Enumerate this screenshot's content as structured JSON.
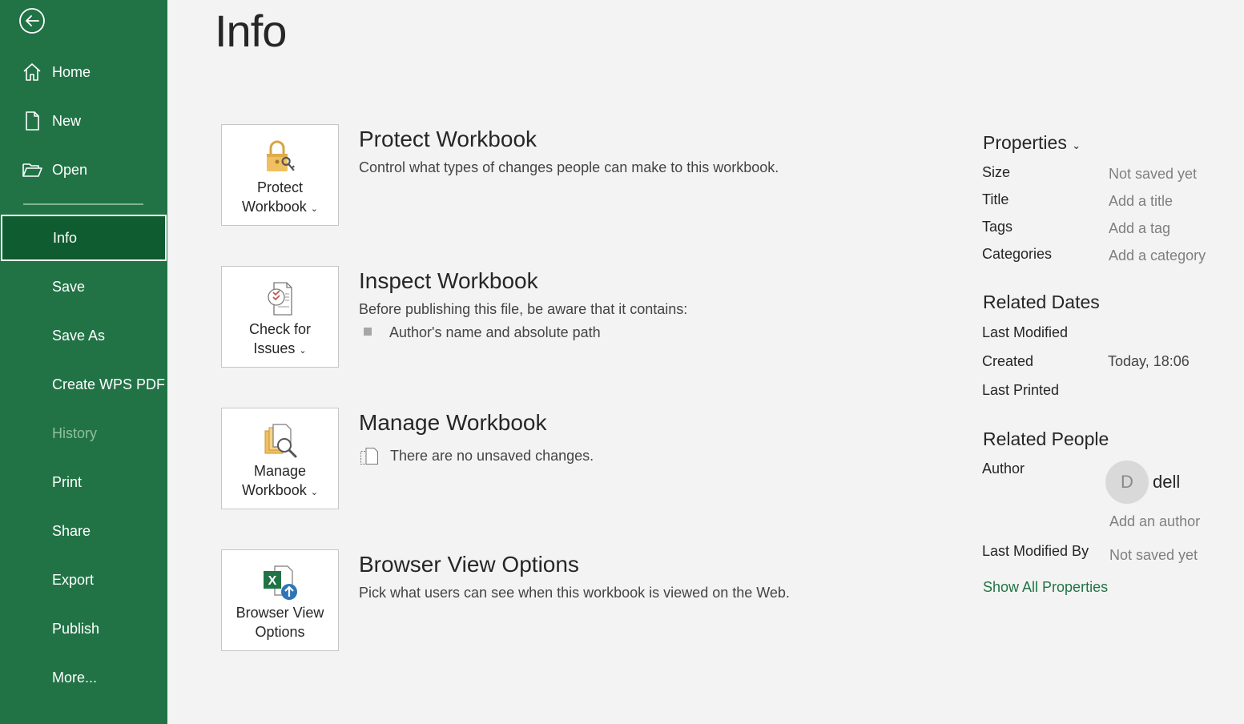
{
  "sidebar": {
    "items": [
      {
        "label": "Home"
      },
      {
        "label": "New"
      },
      {
        "label": "Open"
      },
      {
        "label": "Info"
      },
      {
        "label": "Save"
      },
      {
        "label": "Save As"
      },
      {
        "label": "Create WPS PDF"
      },
      {
        "label": "History"
      },
      {
        "label": "Print"
      },
      {
        "label": "Share"
      },
      {
        "label": "Export"
      },
      {
        "label": "Publish"
      },
      {
        "label": "More..."
      }
    ],
    "accent": "#217346",
    "active_bg": "#0e5c2f"
  },
  "page": {
    "title": "Info"
  },
  "sections": [
    {
      "button_line1": "Protect",
      "button_line2": "Workbook",
      "title": "Protect Workbook",
      "desc": "Control what types of changes people can make to this workbook."
    },
    {
      "button_line1": "Check for",
      "button_line2": "Issues",
      "title": "Inspect Workbook",
      "desc": "Before publishing this file, be aware that it contains:",
      "bullet": "Author's name and absolute path"
    },
    {
      "button_line1": "Manage",
      "button_line2": "Workbook",
      "title": "Manage Workbook",
      "desc": "There are no unsaved changes."
    },
    {
      "button_line1": "Browser View",
      "button_line2": "Options",
      "title": "Browser View Options",
      "desc": "Pick what users can see when this workbook is viewed on the Web."
    }
  ],
  "properties": {
    "heading": "Properties",
    "size_label": "Size",
    "size_value": "Not saved yet",
    "title_label": "Title",
    "title_value": "Add a title",
    "tags_label": "Tags",
    "tags_value": "Add a tag",
    "categories_label": "Categories",
    "categories_value": "Add a category",
    "dates_heading": "Related Dates",
    "last_modified_label": "Last Modified",
    "created_label": "Created",
    "created_value": "Today, 18:06",
    "last_printed_label": "Last Printed",
    "people_heading": "Related People",
    "author_label": "Author",
    "author_initial": "D",
    "author_name": "dell",
    "add_author": "Add an author",
    "last_modified_by_label": "Last Modified By",
    "last_modified_by_value": "Not saved yet",
    "show_all": "Show All Properties"
  }
}
